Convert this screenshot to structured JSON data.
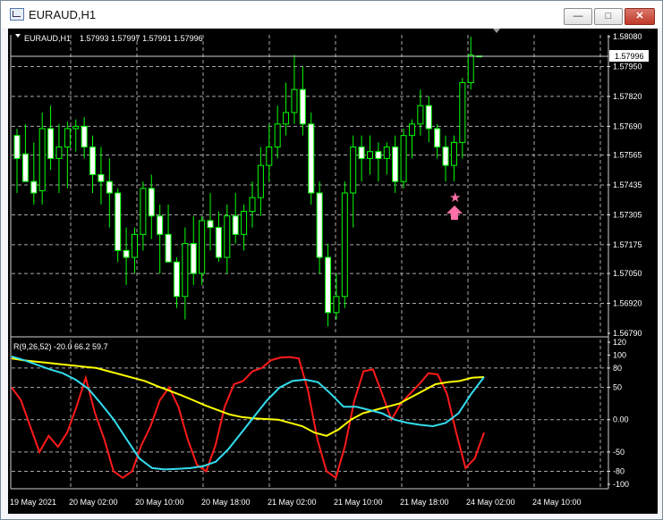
{
  "window": {
    "title": "EURAUD,H1",
    "min_icon": "minimize-icon",
    "max_icon": "maximize-icon",
    "close_icon": "close-icon"
  },
  "chart_header": {
    "symbol": "EURAUD,H1",
    "ohlc": "1.57993 1.57997 1.57991 1.57996"
  },
  "price_axis": {
    "labels": [
      "1.58080",
      "1.57950",
      "1.57820",
      "1.57690",
      "1.57565",
      "1.57435",
      "1.57305",
      "1.57175",
      "1.57050",
      "1.56920",
      "1.56790"
    ],
    "current_price": "1.57996"
  },
  "indicator": {
    "header": "R(9,26,52) -20.0 66.2 59.7",
    "axis_labels": [
      "120",
      "100",
      "80",
      "50",
      "0.00",
      "-50",
      "-80",
      "-100"
    ]
  },
  "time_axis": {
    "labels": [
      "19 May 2021",
      "20 May 02:00",
      "20 May 10:00",
      "20 May 18:00",
      "21 May 02:00",
      "21 May 10:00",
      "21 May 18:00",
      "24 May 02:00",
      "24 May 10:00"
    ]
  },
  "colors": {
    "bull": "#000000",
    "bear": "#ffffff",
    "wick": "#00ff00",
    "grid": "#a8a8a8",
    "fast_line": "#ff1a1a",
    "mid_line": "#ffff00",
    "slow_line": "#33ddee",
    "marker": "#ff6fa8"
  },
  "markers": {
    "star_icon": "star-icon",
    "arrow_icon": "up-arrow-icon"
  },
  "chart_data": [
    {
      "type": "candlestick",
      "title": "EURAUD,H1",
      "ylim": [
        1.5679,
        1.5808
      ],
      "ohlc": [
        [
          1.5765,
          1.5768,
          1.574,
          1.5755
        ],
        [
          1.5757,
          1.577,
          1.5745,
          1.5745
        ],
        [
          1.5745,
          1.5762,
          1.5735,
          1.574
        ],
        [
          1.5741,
          1.5775,
          1.5735,
          1.5768
        ],
        [
          1.5768,
          1.5778,
          1.575,
          1.5755
        ],
        [
          1.5755,
          1.577,
          1.574,
          1.576
        ],
        [
          1.576,
          1.5771,
          1.5742,
          1.5768
        ],
        [
          1.5768,
          1.5772,
          1.5758,
          1.5769
        ],
        [
          1.5769,
          1.5773,
          1.5755,
          1.576
        ],
        [
          1.576,
          1.5765,
          1.574,
          1.5748
        ],
        [
          1.5748,
          1.576,
          1.5735,
          1.5745
        ],
        [
          1.5745,
          1.5755,
          1.5725,
          1.574
        ],
        [
          1.574,
          1.5742,
          1.571,
          1.5715
        ],
        [
          1.5715,
          1.5725,
          1.57,
          1.5712
        ],
        [
          1.5712,
          1.5725,
          1.5705,
          1.5722
        ],
        [
          1.5722,
          1.5745,
          1.5715,
          1.5742
        ],
        [
          1.5742,
          1.5748,
          1.572,
          1.573
        ],
        [
          1.573,
          1.5735,
          1.5705,
          1.5722
        ],
        [
          1.5722,
          1.5735,
          1.571,
          1.571
        ],
        [
          1.571,
          1.5712,
          1.569,
          1.5695
        ],
        [
          1.5695,
          1.5725,
          1.5685,
          1.5718
        ],
        [
          1.5718,
          1.573,
          1.57,
          1.5705
        ],
        [
          1.5705,
          1.573,
          1.57,
          1.5728
        ],
        [
          1.5728,
          1.574,
          1.5715,
          1.5725
        ],
        [
          1.5725,
          1.5732,
          1.571,
          1.5712
        ],
        [
          1.5712,
          1.5735,
          1.5705,
          1.573
        ],
        [
          1.573,
          1.574,
          1.5718,
          1.5722
        ],
        [
          1.5722,
          1.5735,
          1.5715,
          1.5732
        ],
        [
          1.5732,
          1.5745,
          1.5725,
          1.5738
        ],
        [
          1.5738,
          1.576,
          1.573,
          1.5752
        ],
        [
          1.5752,
          1.577,
          1.5745,
          1.576
        ],
        [
          1.576,
          1.5778,
          1.5755,
          1.577
        ],
        [
          1.577,
          1.5788,
          1.5765,
          1.5775
        ],
        [
          1.5775,
          1.58,
          1.577,
          1.5785
        ],
        [
          1.5785,
          1.5795,
          1.5765,
          1.577
        ],
        [
          1.577,
          1.5775,
          1.5735,
          1.574
        ],
        [
          1.574,
          1.5745,
          1.5705,
          1.5712
        ],
        [
          1.5712,
          1.5718,
          1.5682,
          1.5688
        ],
        [
          1.5688,
          1.5705,
          1.5685,
          1.5695
        ],
        [
          1.5695,
          1.5745,
          1.569,
          1.574
        ],
        [
          1.574,
          1.5765,
          1.5725,
          1.576
        ],
        [
          1.576,
          1.5765,
          1.5745,
          1.5755
        ],
        [
          1.5755,
          1.5765,
          1.5748,
          1.5758
        ],
        [
          1.5758,
          1.5762,
          1.5745,
          1.5755
        ],
        [
          1.5755,
          1.5762,
          1.5748,
          1.576
        ],
        [
          1.576,
          1.5765,
          1.574,
          1.5745
        ],
        [
          1.5745,
          1.5768,
          1.5742,
          1.5765
        ],
        [
          1.5765,
          1.5772,
          1.5755,
          1.577
        ],
        [
          1.577,
          1.5785,
          1.5765,
          1.5778
        ],
        [
          1.5778,
          1.5782,
          1.5762,
          1.5768
        ],
        [
          1.5768,
          1.577,
          1.5755,
          1.576
        ],
        [
          1.576,
          1.5765,
          1.5745,
          1.5752
        ],
        [
          1.5752,
          1.5765,
          1.5745,
          1.5762
        ],
        [
          1.5762,
          1.579,
          1.5755,
          1.5788
        ],
        [
          1.5788,
          1.5808,
          1.5785,
          1.58
        ],
        [
          1.57993,
          1.57997,
          1.57991,
          1.57996
        ]
      ]
    },
    {
      "type": "line",
      "title": "R(9,26,52) -20.0 66.2 59.7",
      "ylim": [
        -100,
        120
      ],
      "series": [
        {
          "color": "#ff1a1a",
          "values": [
            50,
            30,
            -10,
            -50,
            -25,
            -42,
            -20,
            20,
            65,
            10,
            -30,
            -80,
            -90,
            -80,
            -40,
            -10,
            30,
            50,
            20,
            -30,
            -70,
            -80,
            -40,
            20,
            55,
            60,
            75,
            80,
            92,
            96,
            97,
            95,
            45,
            -30,
            -80,
            -90,
            -40,
            30,
            75,
            78,
            40,
            0,
            25,
            40,
            55,
            72,
            70,
            40,
            -20,
            -75,
            -60,
            -20
          ]
        },
        {
          "color": "#ffff00",
          "values": [
            95,
            92,
            90,
            88,
            86,
            84,
            82,
            80,
            75,
            70,
            65,
            60,
            52,
            45,
            38,
            30,
            22,
            15,
            8,
            4,
            2,
            1,
            0,
            -5,
            -10,
            -20,
            -25,
            -15,
            0,
            10,
            15,
            20,
            25,
            35,
            45,
            55,
            58,
            60,
            65,
            66
          ]
        },
        {
          "color": "#33ddee",
          "values": [
            98,
            92,
            85,
            78,
            72,
            62,
            48,
            25,
            0,
            -30,
            -60,
            -75,
            -77,
            -76,
            -75,
            -72,
            -65,
            -45,
            -20,
            5,
            30,
            50,
            60,
            62,
            58,
            40,
            20,
            20,
            15,
            10,
            0,
            -5,
            -8,
            -10,
            -5,
            10,
            40,
            66
          ]
        }
      ]
    }
  ]
}
